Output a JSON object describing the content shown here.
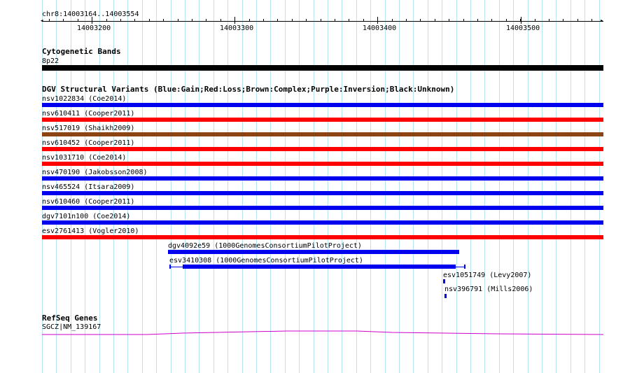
{
  "ruler": {
    "region_label": "chr8:14003164..14003554",
    "ticks": [
      "14003200",
      "14003300",
      "14003400",
      "14003500"
    ]
  },
  "cytoband": {
    "title": "Cytogenetic Bands",
    "band_label": "8p22",
    "color": "#000000"
  },
  "dgv": {
    "title": "DGV Structural Variants (Blue:Gain;Red:Loss;Brown:Complex;Purple:Inversion;Black:Unknown)",
    "colors": {
      "gain": "#0000ee",
      "loss": "#ff0000",
      "complex": "#8b4513"
    },
    "full_rows": [
      {
        "label": "nsv1022834 (Coe2014)",
        "type": "gain"
      },
      {
        "label": "nsv610411 (Cooper2011)",
        "type": "loss"
      },
      {
        "label": "nsv517019 (Shaikh2009)",
        "type": "complex"
      },
      {
        "label": "nsv610452 (Cooper2011)",
        "type": "loss"
      },
      {
        "label": "nsv1031710 (Coe2014)",
        "type": "loss"
      },
      {
        "label": "nsv470190 (Jakobsson2008)",
        "type": "gain"
      },
      {
        "label": "nsv465524 (Itsara2009)",
        "type": "gain"
      },
      {
        "label": "nsv610460 (Cooper2011)",
        "type": "gain"
      },
      {
        "label": "dgv7101n100 (Coe2014)",
        "type": "gain"
      },
      {
        "label": "esv2761413 (Vogler2010)",
        "type": "loss"
      }
    ],
    "partial": {
      "dgv4092e59": "dgv4092e59 (1000GenomesConsortiumPilotProject)",
      "esv3410308": "esv3410308 (1000GenomesConsortiumPilotProject)",
      "esv1051749": "esv1051749 (Levy2007)",
      "nsv396791": "nsv396791 (Mills2006)"
    }
  },
  "refseq": {
    "title": "RefSeq Genes",
    "gene_label": "SGCZ|NM_139167",
    "color": "#cc00cc"
  }
}
